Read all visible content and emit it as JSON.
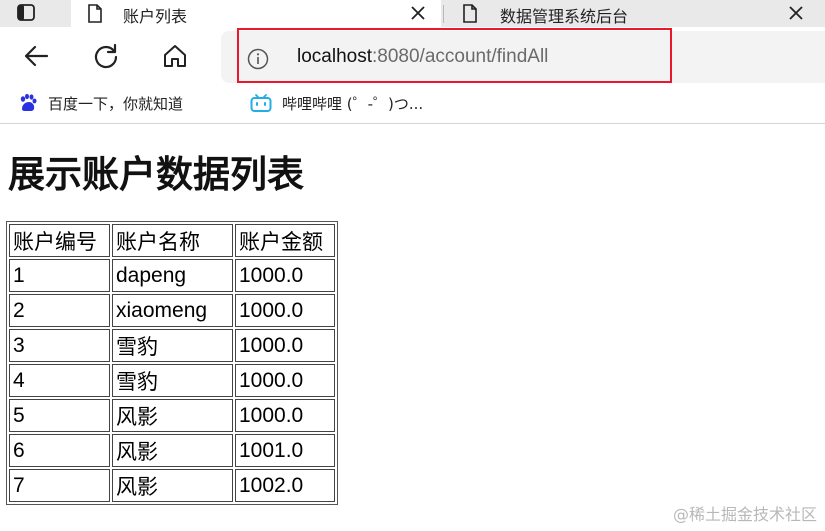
{
  "tabs": [
    {
      "title": "账户列表",
      "active": true
    },
    {
      "title": "数据管理系统后台",
      "active": false
    }
  ],
  "address_bar": {
    "host": "localhost",
    "path": ":8080/account/findAll"
  },
  "bookmarks": [
    {
      "label": "百度一下，你就知道",
      "icon": "baidu-paw-icon"
    },
    {
      "label": "哔哩哔哩 (゜-゜)つ...",
      "icon": "bilibili-tv-icon"
    }
  ],
  "page": {
    "heading": "展示账户数据列表",
    "table": {
      "headers": [
        "账户编号",
        "账户名称",
        "账户金额"
      ],
      "rows": [
        [
          "1",
          "dapeng",
          "1000.0"
        ],
        [
          "2",
          "xiaomeng",
          "1000.0"
        ],
        [
          "3",
          "雪豹",
          "1000.0"
        ],
        [
          "4",
          "雪豹",
          "1000.0"
        ],
        [
          "5",
          "风影",
          "1000.0"
        ],
        [
          "6",
          "风影",
          "1001.0"
        ],
        [
          "7",
          "风影",
          "1002.0"
        ]
      ]
    }
  },
  "watermark": "@稀土掘金技术社区",
  "colors": {
    "highlight_box": "#e8192c",
    "tab_strip": "#e9e9e9",
    "address_bar": "#f3f3f3"
  }
}
